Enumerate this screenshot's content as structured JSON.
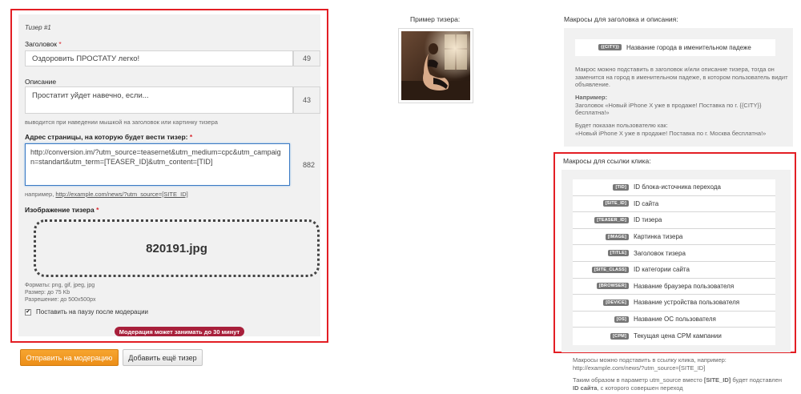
{
  "form": {
    "teaser_title": "Тизер #1",
    "headline": {
      "label": "Заголовок",
      "value": "Оздоровить ПРОСТАТУ легко!",
      "counter": "49"
    },
    "description": {
      "label": "Описание",
      "value": "Простатит уйдет навечно, если...",
      "counter": "43",
      "hint": "выводится при наведении мышкой на заголовок или картинку тизера"
    },
    "url": {
      "label": "Адрес страницы, на которую будет вести тизер:",
      "value": "http://conversion.im/?utm_source=teasernet&utm_medium=cpc&utm_campaign=standart&utm_term=[TEASER_ID]&utm_content=[TID]",
      "counter": "882",
      "hint_prefix": "например,",
      "hint_link": "http://example.com/news/?utm_source=[SITE_ID]"
    },
    "image": {
      "label": "Изображение тизера",
      "filename": "820191.jpg",
      "formats": "Форматы: png, gif, jpeg, jpg",
      "size": "Размер: до 75 Kb",
      "resolution": "Разрешение: до 500x500px"
    },
    "pause_label": "Поставить на паузу после модерации",
    "pause_checked": true,
    "moderation_badge": "Модерация может занимать до 30 минут",
    "required_mark": "*"
  },
  "buttons": {
    "submit": "Отправить на модерацию",
    "add": "Добавить ещё тизер"
  },
  "preview": {
    "title": "Пример тизера:"
  },
  "headline_macros": {
    "title": "Макросы для заголовка и описания:",
    "items": [
      {
        "key": "{{CITY}}",
        "desc": "Название города в именительном падеже"
      }
    ],
    "text1": "Макрос можно подставить в заголовок и/или описание тизера, тогда он заменится на город в именительном падеже, в котором пользователь видит объявление.",
    "example_title": "Например:",
    "example_line": "Заголовок «Новый iPhone X уже в продаже! Поставка по г. {{CITY}} бесплатна!»",
    "shown_to": "Будет показан пользователю как:",
    "shown_line": "«Новый iPhone X уже в продаже! Поставка по г. Москва бесплатна!»"
  },
  "click_macros": {
    "title": "Макросы для ссылки клика:",
    "items": [
      {
        "key": "[TID]",
        "desc": "ID блока-источника перехода"
      },
      {
        "key": "[SITE_ID]",
        "desc": "ID сайта"
      },
      {
        "key": "[TEASER_ID]",
        "desc": "ID тизера"
      },
      {
        "key": "[IMAGE]",
        "desc": "Картинка тизера"
      },
      {
        "key": "[TITLE]",
        "desc": "Заголовок тизера"
      },
      {
        "key": "[SITE_CLASS]",
        "desc": "ID категории сайта"
      },
      {
        "key": "[BROWSER]",
        "desc": "Название браузера пользователя"
      },
      {
        "key": "[DEVICE]",
        "desc": "Название устройства пользователя"
      },
      {
        "key": "[OS]",
        "desc": "Название ОС пользователя"
      },
      {
        "key": "[CPM]",
        "desc": "Текущая цена CPM кампании"
      }
    ],
    "text1": "Макросы можно подставить в ссылку клика, например:",
    "text1_link": "http://example.com/news/?utm_source=[SITE_ID]",
    "text2_prefix": "Таким образом в параметр utm_source вместо",
    "text2_key": "[SITE_ID]",
    "text2_suffix": "будет подставлен",
    "text3_bold": "ID сайта",
    "text3_rest": ", с которого совершен переход"
  },
  "colors": {
    "highlight_border": "#e31e24",
    "submit_button": "#f29a22",
    "badge": "#a8203b",
    "tag": "#777777"
  }
}
